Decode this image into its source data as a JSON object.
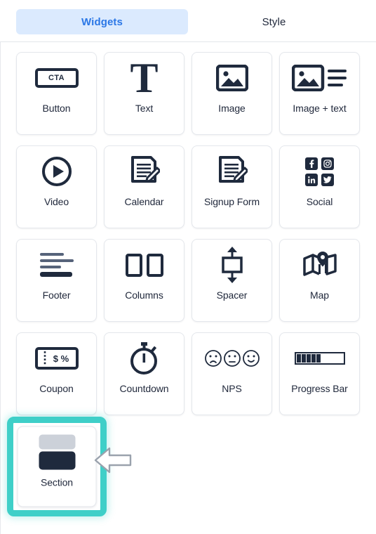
{
  "tabs": [
    {
      "label": "Widgets",
      "active": true
    },
    {
      "label": "Style",
      "active": false
    }
  ],
  "colors": {
    "accent_blue": "#2b77e6",
    "tab_active_bg": "#dbeafe",
    "icon_dark": "#1f2a3d",
    "highlight_teal": "#3fcfc8",
    "card_border": "#e4e7ec",
    "section_icon_light": "#ccd1d9"
  },
  "widgets": [
    {
      "label": "Button",
      "icon": "cta-button-icon"
    },
    {
      "label": "Text",
      "icon": "text-t-icon"
    },
    {
      "label": "Image",
      "icon": "image-icon"
    },
    {
      "label": "Image + text",
      "icon": "image-text-icon"
    },
    {
      "label": "Video",
      "icon": "video-play-icon"
    },
    {
      "label": "Calendar",
      "icon": "document-pencil-icon"
    },
    {
      "label": "Signup Form",
      "icon": "document-pencil-icon"
    },
    {
      "label": "Social",
      "icon": "social-networks-icon"
    },
    {
      "label": "Footer",
      "icon": "footer-lines-icon"
    },
    {
      "label": "Columns",
      "icon": "two-columns-icon"
    },
    {
      "label": "Spacer",
      "icon": "vertical-arrows-icon"
    },
    {
      "label": "Map",
      "icon": "map-pin-icon"
    },
    {
      "label": "Coupon",
      "icon": "coupon-ticket-icon"
    },
    {
      "label": "Countdown",
      "icon": "stopwatch-icon"
    },
    {
      "label": "NPS",
      "icon": "smiley-faces-icon"
    },
    {
      "label": "Progress Bar",
      "icon": "progress-bar-icon"
    }
  ],
  "button_icon": {
    "text": "CTA"
  },
  "text_icon": {
    "glyph": "T"
  },
  "social_icon": {
    "networks": [
      "facebook",
      "instagram",
      "linkedin",
      "twitter"
    ]
  },
  "coupon_icon": {
    "text": "$ %"
  },
  "progress_icon": {
    "segments": 5,
    "percent": 50
  },
  "highlighted": {
    "label": "Section",
    "icon": "section-blocks-icon",
    "annotation": "left-pointing-arrow-cursor"
  }
}
